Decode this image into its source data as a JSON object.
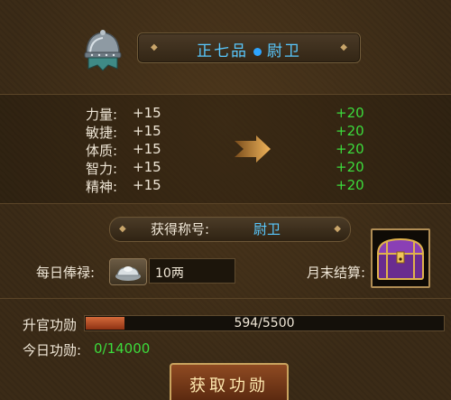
{
  "header": {
    "rank_title_prefix": "正七品",
    "rank_title_name": "尉卫",
    "icons": {
      "helmet": "helmet-icon",
      "dot": "dot-icon"
    }
  },
  "stats": [
    {
      "name": "力量:",
      "current": "+15",
      "next": "+20"
    },
    {
      "name": "敏捷:",
      "current": "+15",
      "next": "+20"
    },
    {
      "name": "体质:",
      "current": "+15",
      "next": "+20"
    },
    {
      "name": "智力:",
      "current": "+15",
      "next": "+20"
    },
    {
      "name": "精神:",
      "current": "+15",
      "next": "+20"
    }
  ],
  "rank": {
    "label": "获得称号:",
    "value": "尉卫"
  },
  "salary": {
    "label": "每日俸禄:",
    "value": "10两",
    "icon": "silver-ingot-icon"
  },
  "month_end": {
    "label": "月末结算:",
    "icon": "treasure-chest-icon"
  },
  "promotion": {
    "label": "升官功勋",
    "progress_text": "594/5500",
    "current": 594,
    "total": 5500
  },
  "today": {
    "label": "今日功勋:",
    "value": "0/14000"
  },
  "action_button": {
    "label": "获取功勋"
  },
  "colors": {
    "accent_blue": "#59c9ff",
    "green": "#3cdb3c",
    "text": "#efe6d6",
    "gold": "#c9a35e"
  }
}
